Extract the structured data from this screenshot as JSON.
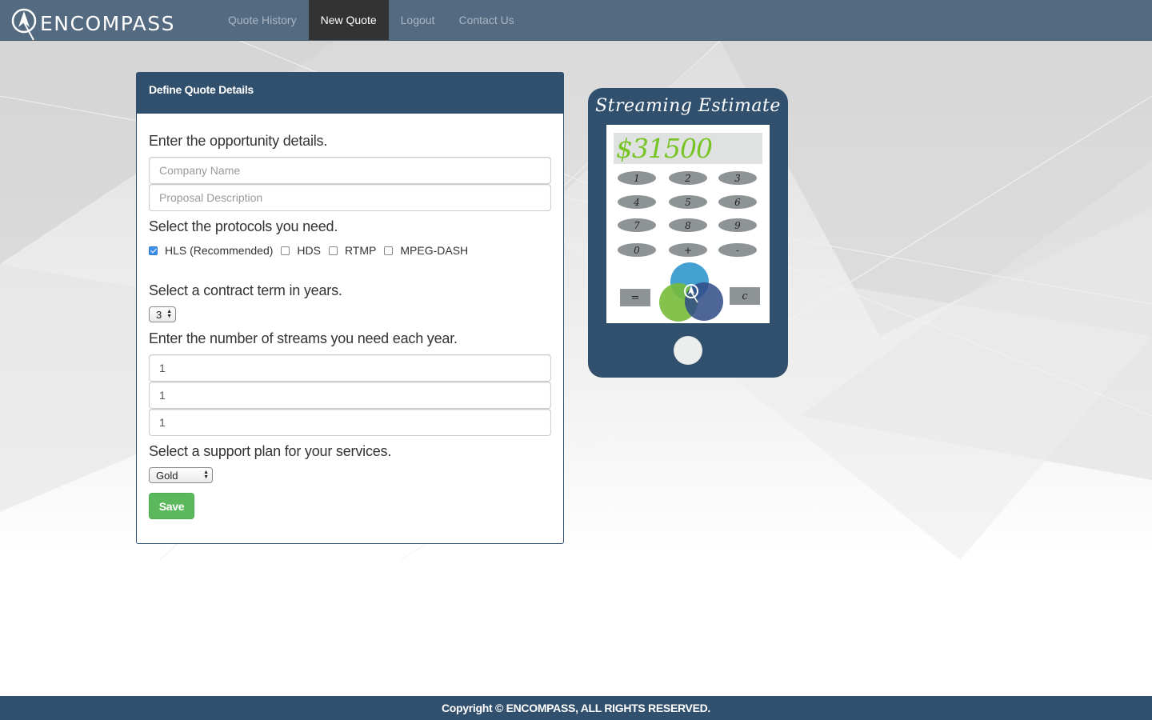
{
  "brand": {
    "name": "ENCOMPASS"
  },
  "nav": {
    "items": [
      {
        "label": "Quote History",
        "active": false
      },
      {
        "label": "New Quote",
        "active": true
      },
      {
        "label": "Logout",
        "active": false
      },
      {
        "label": "Contact Us",
        "active": false
      }
    ]
  },
  "panel": {
    "heading": "Define Quote Details",
    "opportunity": {
      "label": "Enter the opportunity details.",
      "company_placeholder": "Company Name",
      "description_placeholder": "Proposal Description"
    },
    "protocols": {
      "label": "Select the protocols you need.",
      "options": [
        {
          "label": "HLS (Recommended)",
          "checked": true
        },
        {
          "label": "HDS",
          "checked": false
        },
        {
          "label": "RTMP",
          "checked": false
        },
        {
          "label": "MPEG-DASH",
          "checked": false
        }
      ]
    },
    "term": {
      "label": "Select a contract term in years.",
      "value": "3"
    },
    "streams": {
      "label": "Enter the number of streams you need each year.",
      "values": [
        "1",
        "1",
        "1"
      ]
    },
    "support": {
      "label": "Select a support plan for your services.",
      "value": "Gold"
    },
    "save_label": "Save"
  },
  "calculator": {
    "title": "Streaming Estimate",
    "display": "$31500",
    "keys": [
      "1",
      "2",
      "3",
      "4",
      "5",
      "6",
      "7",
      "8",
      "9",
      "0",
      "+",
      "-"
    ],
    "equals": "=",
    "clear": "c"
  },
  "footer": {
    "text": "Copyright © ENCOMPASS, ALL RIGHTS RESERVED."
  },
  "colors": {
    "navbar": "#536a80",
    "panel_heading": "#31506e",
    "save_button": "#5cb85c",
    "display_text": "#77c425"
  }
}
